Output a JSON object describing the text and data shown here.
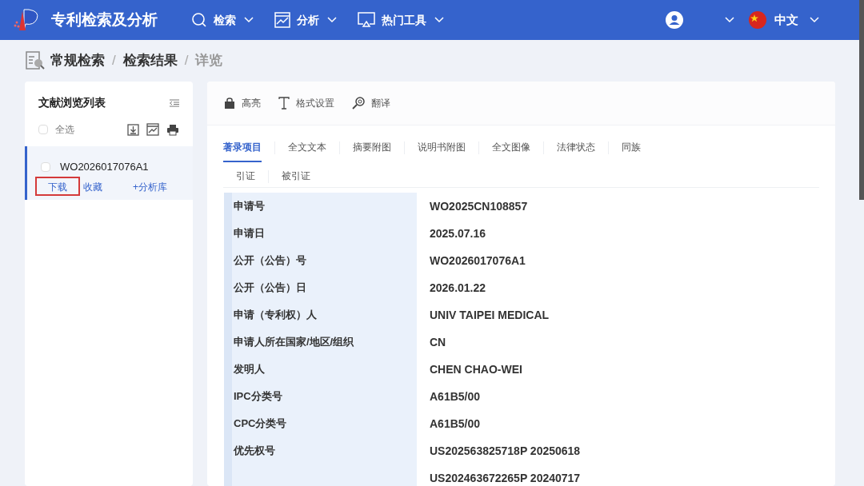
{
  "app": {
    "title": "专利检索及分析"
  },
  "nav": [
    {
      "kind": "search",
      "label": "检索"
    },
    {
      "kind": "chart",
      "label": "分析"
    },
    {
      "kind": "monitor",
      "label": "热门工具"
    }
  ],
  "language": {
    "label": "中文"
  },
  "breadcrumb": [
    "常规检索",
    "检索结果",
    "详览"
  ],
  "breadcrumb_separator": "/",
  "list_panel": {
    "title": "文献浏览列表",
    "select_all": {
      "label": "全选",
      "checked": false
    },
    "items": [
      {
        "number": "WO2026017076A1",
        "checked": false,
        "selected": true,
        "actions": [
          {
            "label": "下载",
            "highlighted": true
          },
          {
            "label": "收藏",
            "highlighted": false
          },
          {
            "label": "+分析库",
            "highlighted": false
          }
        ]
      }
    ]
  },
  "toolbar": [
    {
      "kind": "bag",
      "label": "高亮"
    },
    {
      "kind": "text",
      "label": "格式设置"
    },
    {
      "kind": "magnifier",
      "label": "翻译"
    }
  ],
  "tabs": [
    {
      "label": "著录项目",
      "selected": true
    },
    {
      "label": "全文文本",
      "selected": false
    },
    {
      "label": "摘要附图",
      "selected": false
    },
    {
      "label": "说明书附图",
      "selected": false
    },
    {
      "label": "全文图像",
      "selected": false
    },
    {
      "label": "法律状态",
      "selected": false
    },
    {
      "label": "同族",
      "selected": false
    }
  ],
  "subtabs": [
    {
      "label": "引证",
      "selected": false
    },
    {
      "label": "被引证",
      "selected": false
    }
  ],
  "fields": [
    {
      "label": "申请号",
      "values": [
        "WO2025CN108857"
      ]
    },
    {
      "label": "申请日",
      "values": [
        "2025.07.16"
      ]
    },
    {
      "label": "公开（公告）号",
      "values": [
        "WO2026017076A1"
      ]
    },
    {
      "label": "公开（公告）日",
      "values": [
        "2026.01.22"
      ]
    },
    {
      "label": "申请（专利权）人",
      "values": [
        "UNIV TAIPEI MEDICAL"
      ]
    },
    {
      "label": "申请人所在国家/地区/组织",
      "values": [
        "CN"
      ]
    },
    {
      "label": "发明人",
      "values": [
        "CHEN CHAO-WEI"
      ]
    },
    {
      "label": "IPC分类号",
      "values": [
        "A61B5/00"
      ]
    },
    {
      "label": "CPC分类号",
      "values": [
        "A61B5/00"
      ]
    },
    {
      "label": "优先权号",
      "values": [
        "US202563825718P 20250618",
        "US202463672265P 20240717"
      ]
    }
  ]
}
